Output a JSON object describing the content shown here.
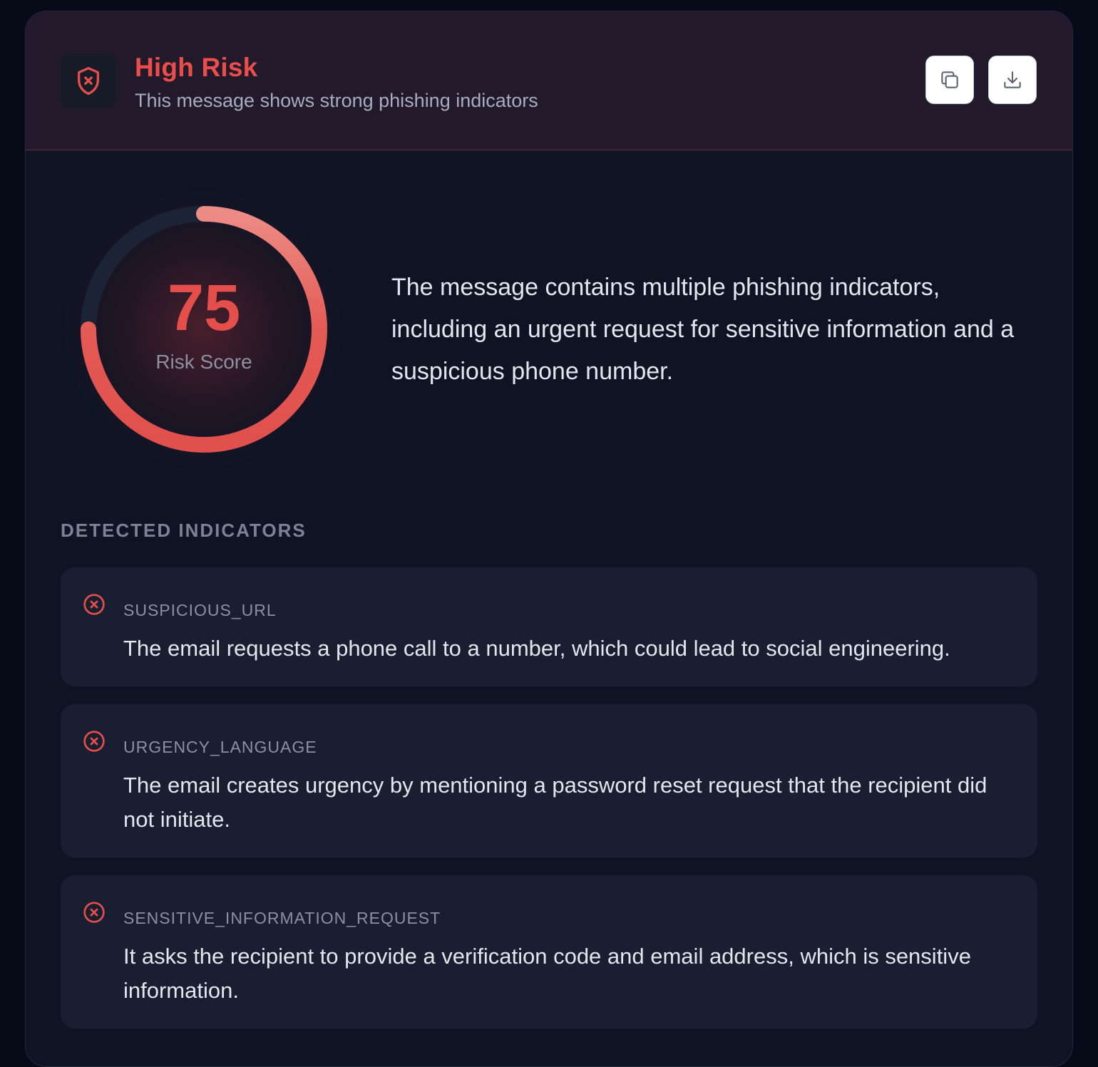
{
  "header": {
    "title": "High Risk",
    "subtitle": "This message shows strong phishing indicators",
    "icon": "shield-x-icon",
    "actions": [
      {
        "name": "copy-button",
        "icon": "copy-icon"
      },
      {
        "name": "download-button",
        "icon": "download-icon"
      }
    ]
  },
  "risk": {
    "score": "75",
    "label": "Risk Score",
    "fraction": 0.75
  },
  "summary": "The message contains multiple phishing indicators, including an urgent request for sensitive information and a suspicious phone number.",
  "indicators": {
    "title": "DETECTED INDICATORS",
    "items": [
      {
        "name": "SUSPICIOUS_URL",
        "description": "The email requests a phone call to a number, which could lead to social engineering."
      },
      {
        "name": "URGENCY_LANGUAGE",
        "description": "The email creates urgency by mentioning a password reset request that the recipient did not initiate."
      },
      {
        "name": "SENSITIVE_INFORMATION_REQUEST",
        "description": "It asks the recipient to provide a verification code and email address, which is sensitive information."
      }
    ]
  },
  "colors": {
    "accent": "#e44f4b",
    "accent_light": "#ec8c85",
    "background": "#0e1424",
    "header_bg": "#221a2a"
  }
}
